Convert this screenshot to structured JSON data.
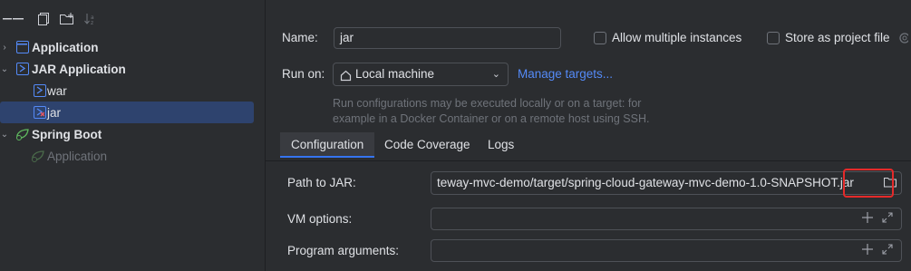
{
  "sidebar": {
    "toolbar_icons": [
      "add-icon",
      "remove-icon",
      "copy-icon",
      "new-folder-icon",
      "sort-icon"
    ],
    "items": [
      {
        "label": "Application",
        "icon": "application-config-icon",
        "expandable": true
      },
      {
        "label": "JAR Application",
        "icon": "jar-config-icon",
        "expandable": true
      },
      {
        "label": "war",
        "icon": "jar-config-icon"
      },
      {
        "label": "jar",
        "icon": "jar-config-error-icon",
        "selected": true
      },
      {
        "label": "Spring Boot",
        "icon": "spring-boot-icon",
        "expandable": true
      },
      {
        "label": "Application",
        "icon": "spring-boot-icon",
        "disabled": true
      }
    ]
  },
  "form": {
    "name_label": "Name:",
    "name_value": "jar",
    "allow_multiple_label": "Allow multiple instances",
    "store_project_label": "Store as project file",
    "run_on_label": "Run on:",
    "run_on_value": "Local machine",
    "manage_targets": "Manage targets...",
    "hint_line1": "Run configurations may be executed locally or on a target: for",
    "hint_line2": "example in a Docker Container or on a remote host using SSH."
  },
  "tabs": [
    "Configuration",
    "Code Coverage",
    "Logs"
  ],
  "config": {
    "path_label": "Path to JAR:",
    "path_value": "teway-mvc-demo/target/spring-cloud-gateway-mvc-demo-1.0-SNAPSHOT.jar",
    "vm_label": "VM options:",
    "vm_value": "",
    "args_label": "Program arguments:",
    "args_value": ""
  },
  "colors": {
    "accent": "#3574f0",
    "link": "#548af7",
    "highlight": "#e52a2a"
  }
}
